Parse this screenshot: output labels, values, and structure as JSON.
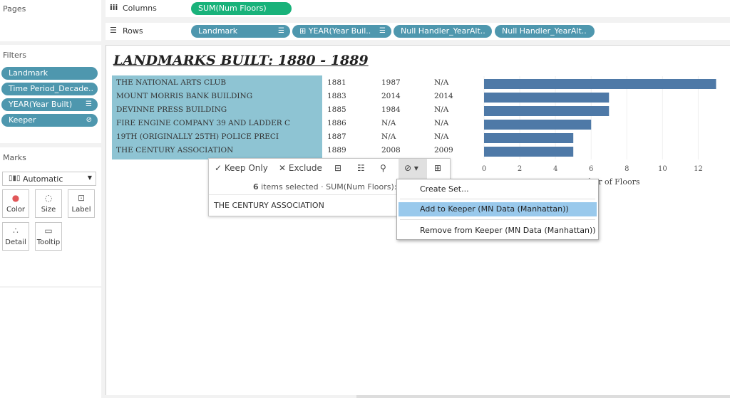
{
  "pages": {
    "title": "Pages"
  },
  "columns_shelf": {
    "label": "Columns",
    "pills": [
      "SUM(Num Floors)"
    ]
  },
  "rows_shelf": {
    "label": "Rows",
    "pills": [
      "Landmark",
      "YEAR(Year Buil..",
      "Null Handler_YearAlt..",
      "Null Handler_YearAlt.."
    ]
  },
  "filters": {
    "title": "Filters",
    "items": [
      "Landmark",
      "Time Period_Decade..",
      "YEAR(Year Built)",
      "Keeper"
    ]
  },
  "marks": {
    "title": "Marks",
    "type": "Automatic",
    "buttons": [
      "Color",
      "Size",
      "Label",
      "Detail",
      "Tooltip"
    ]
  },
  "view": {
    "title": "LANDMARKS BUILT: 1880 - 1889",
    "rows": [
      {
        "name": "THE NATIONAL ARTS CLUB",
        "year": "1881",
        "alt1": "1987",
        "alt2": "N/A"
      },
      {
        "name": "MOUNT MORRIS BANK BUILDING",
        "year": "1883",
        "alt1": "2014",
        "alt2": "2014"
      },
      {
        "name": "DEVINNE PRESS BUILDING",
        "year": "1885",
        "alt1": "1984",
        "alt2": "N/A"
      },
      {
        "name": "FIRE ENGINE COMPANY 39 AND LADDER C",
        "year": "1886",
        "alt1": "N/A",
        "alt2": "N/A"
      },
      {
        "name": "19TH (ORIGINALLY 25TH) POLICE PRECI",
        "year": "1887",
        "alt1": "N/A",
        "alt2": "N/A"
      },
      {
        "name": "THE CENTURY ASSOCIATION",
        "year": "1889",
        "alt1": "2008",
        "alt2": "2009"
      }
    ],
    "axis_label": "Number of Floors"
  },
  "chart_data": {
    "type": "bar",
    "orientation": "horizontal",
    "categories": [
      "THE NATIONAL ARTS CLUB",
      "MOUNT MORRIS BANK BUILDING",
      "DEVINNE PRESS BUILDING",
      "FIRE ENGINE COMPANY 39 AND LADDER C",
      "19TH (ORIGINALLY 25TH) POLICE PRECI",
      "THE CENTURY ASSOCIATION"
    ],
    "values": [
      13,
      7,
      7,
      6,
      5,
      5
    ],
    "xlabel": "Number of Floors",
    "xticks": [
      0,
      2,
      4,
      6,
      8,
      10,
      12
    ],
    "xlim": [
      0,
      13.5
    ],
    "color": "#4e79a7"
  },
  "tooltip": {
    "keep_only": "Keep Only",
    "exclude": "Exclude",
    "count": "6",
    "selected_text": "items selected",
    "measure": "SUM(Num Floors): 4",
    "hovered": "THE CENTURY ASSOCIATION"
  },
  "context_menu": {
    "items": [
      "Create Set...",
      "Add to Keeper (MN Data (Manhattan))",
      "Remove from Keeper (MN Data (Manhattan))"
    ]
  },
  "colors": {
    "pill": "#4e97ae",
    "measure_pill": "#19b27a",
    "bar": "#4e79a7",
    "highlight": "#8ec4d3",
    "menu_active": "#99c9ec"
  }
}
